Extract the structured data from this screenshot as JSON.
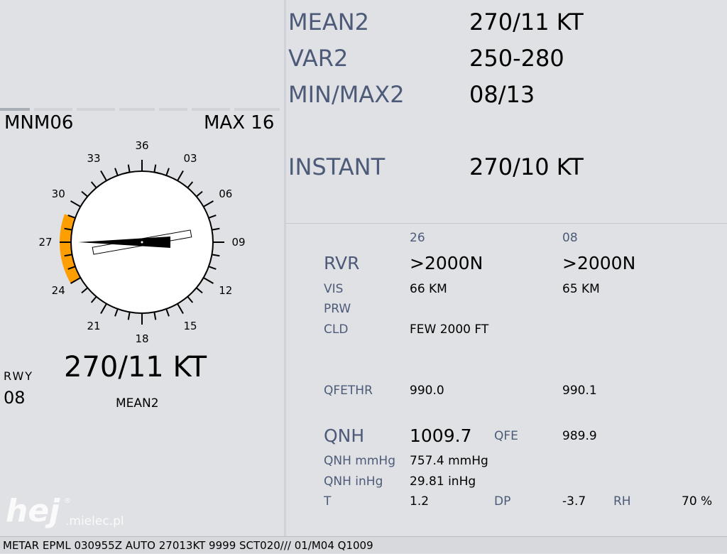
{
  "wind_top": {
    "rows": [
      {
        "label": "MEAN2",
        "value": "270/11 KT"
      },
      {
        "label": "VAR2",
        "value": "250-280"
      },
      {
        "label": "MIN/MAX2",
        "value": "08/13"
      },
      {
        "label": "INSTANT",
        "value": "270/10 KT"
      }
    ]
  },
  "runways": {
    "col1": "26",
    "col2": "08"
  },
  "rvr": {
    "label": "RVR",
    "col1": ">2000N",
    "col2": ">2000N"
  },
  "vis": {
    "label": "VIS",
    "col1": "66 KM",
    "col2": "65 KM"
  },
  "prw": {
    "label": "PRW"
  },
  "cld": {
    "label": "CLD",
    "col1": "FEW 2000 FT"
  },
  "qfethr": {
    "label": "QFETHR",
    "col1": "990.0",
    "col2": "990.1"
  },
  "qnh": {
    "label": "QNH",
    "value": "1009.7",
    "qfe_label": "QFE",
    "qfe_value": "989.9"
  },
  "qnh_mmhg": {
    "label": "QNH mmHg",
    "value": "757.4 mmHg"
  },
  "qnh_inhg": {
    "label": "QNH inHg",
    "value": "29.81 inHg"
  },
  "temps": {
    "t_label": "T",
    "t_value": "1.2",
    "dp_label": "DP",
    "dp_value": "-3.7",
    "rh_label": "RH",
    "rh_value": "70 %"
  },
  "rose": {
    "mnm_label": "MNM",
    "mnm_value": "06",
    "max_label": "MAX",
    "max_value": "16",
    "ticks": [
      "36",
      "03",
      "06",
      "09",
      "12",
      "15",
      "18",
      "21",
      "24",
      "27",
      "30",
      "33"
    ],
    "wind_direction_deg": 270,
    "variation_from_deg": 250,
    "variation_to_deg": 280,
    "runway_heading_deg": 80,
    "colors": {
      "variation_outer": "#ff9e00",
      "variation_inner": "#ffff00"
    }
  },
  "wind_main": {
    "value": "270/11 KT",
    "caption": "MEAN2"
  },
  "rwy": {
    "label": "RWY",
    "value": "08"
  },
  "metar": "METAR EPML 030955Z AUTO 27013KT 9999 SCT020/// 01/M04 Q1009",
  "watermark": {
    "text": "hej",
    "suffix": ".mielec.pl",
    "mark": "®"
  }
}
